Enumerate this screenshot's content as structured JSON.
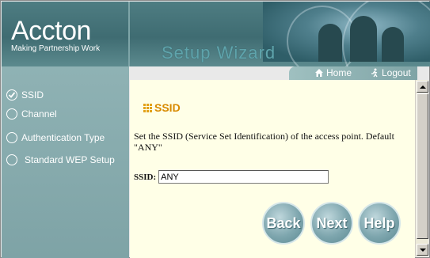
{
  "header": {
    "brand": "Accton",
    "tagline": "Making Partnership Work",
    "wizard_title": "Setup Wizard",
    "nav": {
      "home_label": "Home",
      "logout_label": "Logout",
      "home_icon": "home-icon",
      "logout_icon": "logout-icon"
    }
  },
  "sidebar": {
    "steps": [
      {
        "label": "SSID",
        "selected": true
      },
      {
        "label": "Channel",
        "selected": false
      },
      {
        "label": "Authentication Type",
        "selected": false
      },
      {
        "label": "Standard WEP Setup",
        "selected": false
      }
    ]
  },
  "main": {
    "section_title": "SSID",
    "description": "Set the SSID (Service Set Identification) of the access point. Default \"ANY\"",
    "ssid_label": "SSID:",
    "ssid_value": "ANY",
    "buttons": {
      "back": "Back",
      "next": "Next",
      "help": "Help"
    }
  },
  "colors": {
    "header": "#4e7d82",
    "sidebar": "#8fb2b4",
    "content_bg": "#ffffe7",
    "accent": "#d88a00",
    "button": "#7ea6ae"
  }
}
